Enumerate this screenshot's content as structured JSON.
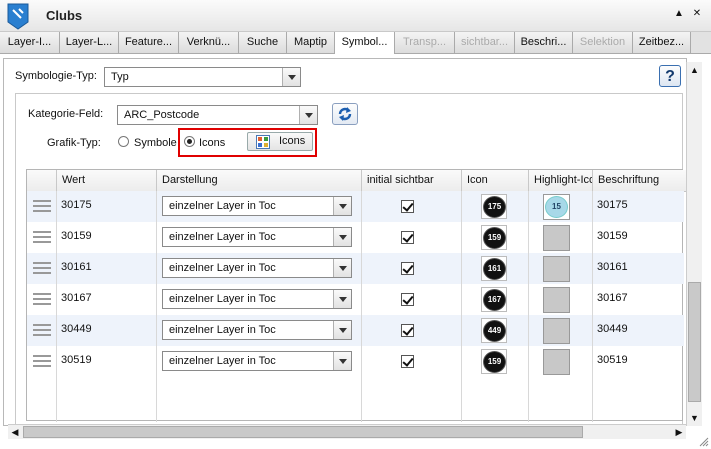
{
  "window": {
    "title": "Clubs",
    "collapse_glyph": "▲",
    "close_glyph": "✕"
  },
  "tabs": [
    {
      "label": "Layer-I...",
      "state": "normal"
    },
    {
      "label": "Layer-L...",
      "state": "normal"
    },
    {
      "label": "Feature...",
      "state": "normal"
    },
    {
      "label": "Verknü...",
      "state": "normal"
    },
    {
      "label": "Suche",
      "state": "normal"
    },
    {
      "label": "Maptip",
      "state": "normal"
    },
    {
      "label": "Symbol...",
      "state": "active"
    },
    {
      "label": "Transp...",
      "state": "disabled"
    },
    {
      "label": "sichtbar...",
      "state": "disabled"
    },
    {
      "label": "Beschri...",
      "state": "normal"
    },
    {
      "label": "Selektion",
      "state": "disabled"
    },
    {
      "label": "Zeitbez...",
      "state": "normal"
    }
  ],
  "symbology": {
    "type_label": "Symbologie-Typ:",
    "type_value": "Typ",
    "help_label": "?"
  },
  "category": {
    "field_label": "Kategorie-Feld:",
    "field_value": "ARC_Postcode",
    "graphic_type_label": "Grafik-Typ:",
    "option_symbole": "Symbole",
    "option_icons": "Icons",
    "selected_option": "Icons",
    "icons_button_label": "Icons"
  },
  "grid": {
    "columns": [
      "",
      "Wert",
      "Darstellung",
      "initial sichtbar",
      "Icon",
      "Highlight-Ico",
      "Beschriftung"
    ],
    "rows": [
      {
        "wert": "30175",
        "darstellung": "einzelner Layer in Toc",
        "sichtbar": true,
        "icon": "175",
        "highlight": "15",
        "beschriftung": "30175"
      },
      {
        "wert": "30159",
        "darstellung": "einzelner Layer in Toc",
        "sichtbar": true,
        "icon": "159",
        "highlight": "",
        "beschriftung": "30159"
      },
      {
        "wert": "30161",
        "darstellung": "einzelner Layer in Toc",
        "sichtbar": true,
        "icon": "161",
        "highlight": "",
        "beschriftung": "30161"
      },
      {
        "wert": "30167",
        "darstellung": "einzelner Layer in Toc",
        "sichtbar": true,
        "icon": "167",
        "highlight": "",
        "beschriftung": "30167"
      },
      {
        "wert": "30449",
        "darstellung": "einzelner Layer in Toc",
        "sichtbar": true,
        "icon": "449",
        "highlight": "",
        "beschriftung": "30449"
      },
      {
        "wert": "30519",
        "darstellung": "einzelner Layer in Toc",
        "sichtbar": true,
        "icon": "159",
        "highlight": "",
        "beschriftung": "30519"
      }
    ]
  },
  "scroll": {
    "up": "▲",
    "down": "▼",
    "left": "◀",
    "right": "▶"
  },
  "colors": {
    "highlight_border": "#e00000",
    "row_alt": "#eef3fb",
    "accent": "#3a6fb0"
  }
}
